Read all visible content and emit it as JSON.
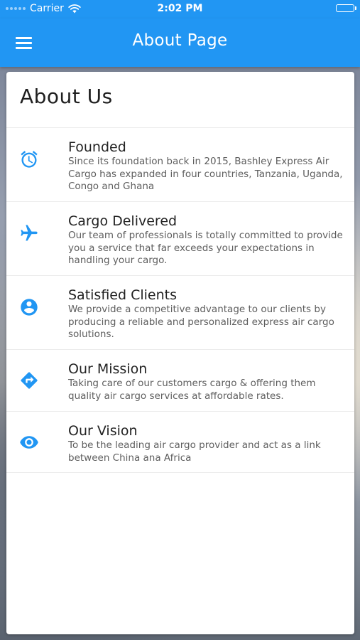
{
  "status": {
    "carrier": "Carrier",
    "time": "2:02 PM"
  },
  "appbar": {
    "title": "About Page",
    "menu_icon": "menu-icon"
  },
  "page": {
    "title": "About Us"
  },
  "accent_color": "#2196F3",
  "items": [
    {
      "icon": "alarm-icon",
      "title": "Founded",
      "text": "Since its foundation back in 2015, Bashley Express Air Cargo has expanded in four countries, Tanzania, Uganda, Congo and Ghana"
    },
    {
      "icon": "airplane-icon",
      "title": "Cargo Delivered",
      "text": "Our team of professionals is totally committed to provide you a service that far exceeds your expectations in handling your cargo."
    },
    {
      "icon": "account-circle-icon",
      "title": "Satisfied Clients",
      "text": "We provide a competitive advantage to our clients by producing a reliable and personalized express air cargo solutions."
    },
    {
      "icon": "directions-icon",
      "title": "Our Mission",
      "text": "Taking care of our customers cargo & offering them quality air cargo services at affordable rates."
    },
    {
      "icon": "eye-icon",
      "title": "Our Vision",
      "text": "To be the leading air cargo provider and act as a link between China ana Africa"
    }
  ]
}
